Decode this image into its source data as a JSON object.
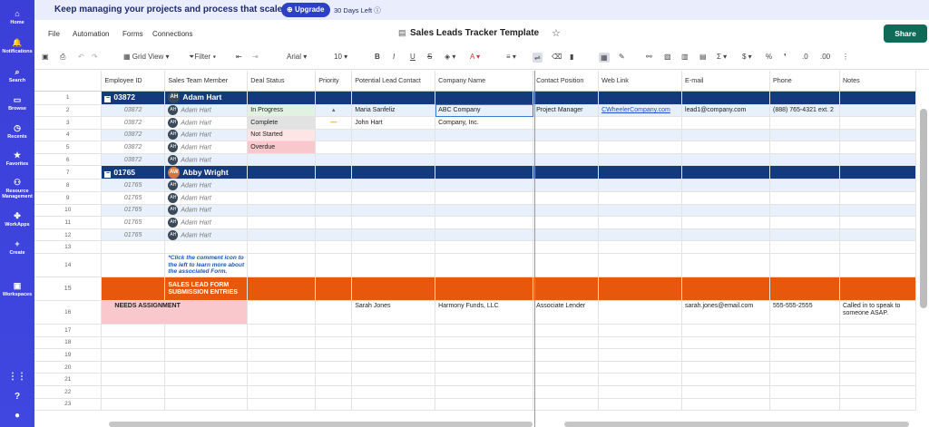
{
  "nav": {
    "items": [
      {
        "icon": "⌂",
        "label": "Home"
      },
      {
        "icon": "🔔",
        "label": "Notifications"
      },
      {
        "icon": "⌕",
        "label": "Search"
      },
      {
        "icon": "▭",
        "label": "Browse"
      },
      {
        "icon": "◷",
        "label": "Recents"
      },
      {
        "icon": "★",
        "label": "Favorites"
      },
      {
        "icon": "⚇",
        "label": "Resource Management"
      },
      {
        "icon": "✤",
        "label": "WorkApps"
      },
      {
        "icon": "+",
        "label": "Create"
      },
      {
        "icon": "▣",
        "label": "Workspaces"
      }
    ]
  },
  "banner": {
    "text": "Keep managing your projects and process that scale.",
    "upgrade_label": "Upgrade",
    "days_left": "30 Days Left"
  },
  "menu": {
    "file": "File",
    "automation": "Automation",
    "forms": "Forms",
    "connections": "Connections",
    "title": "Sales Leads Tracker Template",
    "share": "Share"
  },
  "toolbar": {
    "view": "Grid View",
    "filter": "Filter",
    "font": "Arial",
    "font_size": "10"
  },
  "grid": {
    "columns": [
      "Employee ID",
      "Sales Team Member",
      "Deal Status",
      "Priority",
      "Potential Lead Contact",
      "Company Name",
      "Contact Position",
      "Web Link",
      "E-mail",
      "Phone",
      "Notes"
    ],
    "parent1": {
      "row": "1",
      "id": "03872",
      "initials": "AH",
      "name": "Adam Hart"
    },
    "parent2": {
      "row": "7",
      "id": "01765",
      "initials": "AW",
      "name": "Abby Wright"
    },
    "children1": [
      {
        "row": "2",
        "id": "03872",
        "initials": "AH",
        "name": "Adam Hart",
        "status": "In Progress",
        "priority": "▲",
        "contact": "Maria Sanfeliz",
        "company": "ABC Company",
        "position": "Project Manager",
        "web": "CWheelerCompany.com",
        "email": "lead1@company.com",
        "phone": "(888) 765-4321 ext. 2"
      },
      {
        "row": "3",
        "id": "03872",
        "initials": "AH",
        "name": "Adam Hart",
        "status": "Complete",
        "priority": "—",
        "contact": "John Hart",
        "company": "Company, Inc.",
        "position": "",
        "web": "",
        "email": "",
        "phone": ""
      },
      {
        "row": "4",
        "id": "03872",
        "initials": "AH",
        "name": "Adam Hart",
        "status": "Not Started"
      },
      {
        "row": "5",
        "id": "03872",
        "initials": "AH",
        "name": "Adam Hart",
        "status": "Overdue"
      },
      {
        "row": "6",
        "id": "03872",
        "initials": "AH",
        "name": "Adam Hart",
        "status": ""
      }
    ],
    "children2": [
      {
        "row": "8",
        "id": "01765",
        "initials": "AH",
        "name": "Adam Hart"
      },
      {
        "row": "9",
        "id": "01765",
        "initials": "AH",
        "name": "Adam Hart"
      },
      {
        "row": "10",
        "id": "01765",
        "initials": "AH",
        "name": "Adam Hart"
      },
      {
        "row": "11",
        "id": "01765",
        "initials": "AH",
        "name": "Adam Hart"
      },
      {
        "row": "12",
        "id": "01765",
        "initials": "AH",
        "name": "Adam Hart"
      }
    ],
    "row13": "13",
    "row14": {
      "row": "14",
      "note": "*Click the comment icon to the left to learn more about the associated Form."
    },
    "row15": {
      "row": "15",
      "label": "SALES LEAD FORM SUBMISSION ENTRIES"
    },
    "row16": {
      "row": "16",
      "needs": "NEEDS ASSIGNMENT",
      "contact": "Sarah Jones",
      "company": "Harmony Funds, LLC",
      "position": "Associate Lender",
      "email": "sarah.jones@email.com",
      "phone": "555-555-2555",
      "notes": "Called in to speak to someone ASAP."
    },
    "empty_rows": [
      "17",
      "18",
      "19",
      "20",
      "21",
      "22",
      "23"
    ]
  }
}
